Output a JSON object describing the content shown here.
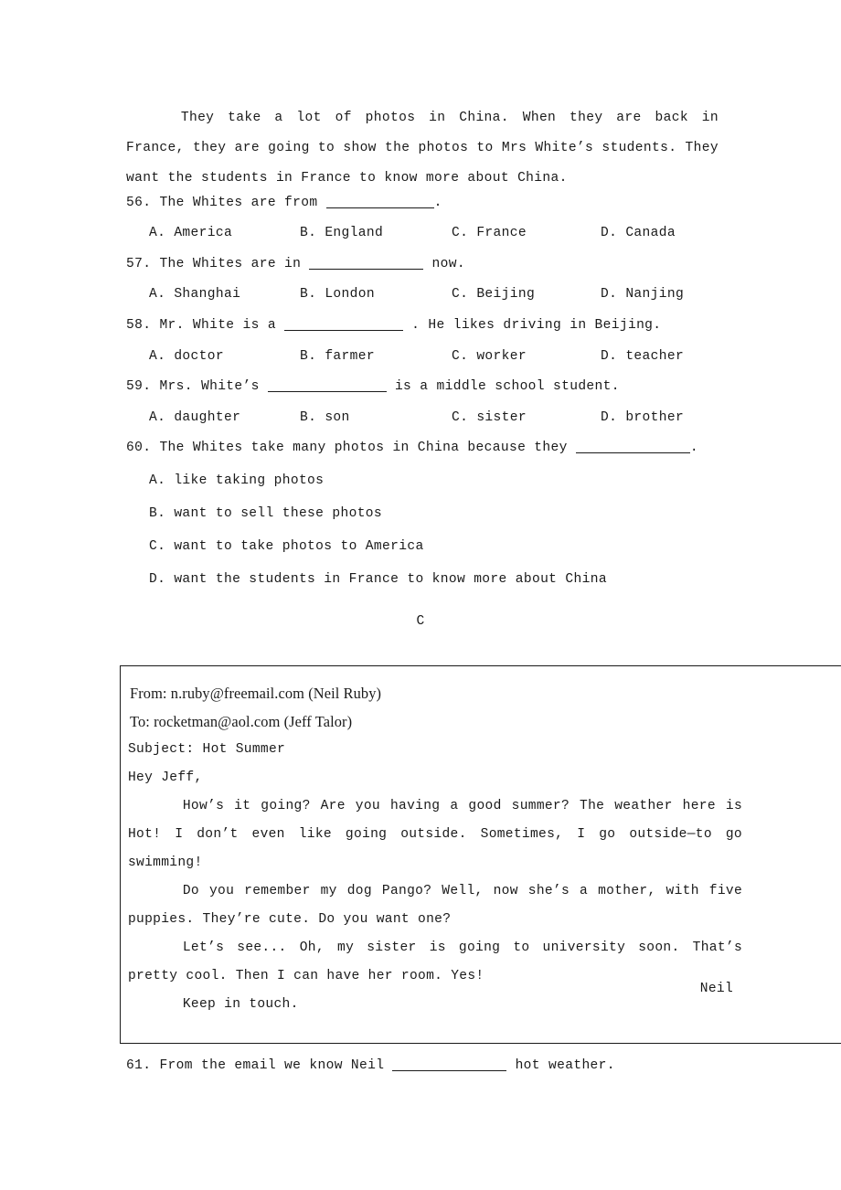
{
  "passage": {
    "lines": [
      "They take a lot of photos in China. When they are back in France, they are",
      "going to show the photos to Mrs White’s students. They want the students in France",
      "to know more about China."
    ]
  },
  "questions": [
    {
      "number": "56.",
      "stem_before": "The Whites are from",
      "stem_after": ".",
      "options": [
        {
          "key": "A.",
          "text": "America"
        },
        {
          "key": "B.",
          "text": "England"
        },
        {
          "key": "C.",
          "text": "France"
        },
        {
          "key": "D.",
          "text": "Canada"
        }
      ]
    },
    {
      "number": "57.",
      "stem_before": "The Whites are in",
      "stem_after": "now.",
      "options": [
        {
          "key": "A.",
          "text": "Shanghai"
        },
        {
          "key": "B.",
          "text": "London"
        },
        {
          "key": "C.",
          "text": "Beijing"
        },
        {
          "key": "D.",
          "text": "Nanjing"
        }
      ]
    },
    {
      "number": "58.",
      "stem_before": "Mr. White is a",
      "stem_after": ". He likes driving in Beijing.",
      "options": [
        {
          "key": "A.",
          "text": "doctor"
        },
        {
          "key": "B.",
          "text": "farmer"
        },
        {
          "key": "C.",
          "text": "worker"
        },
        {
          "key": "D.",
          "text": "teacher"
        }
      ]
    },
    {
      "number": "59.",
      "stem_before": "Mrs. White’s",
      "stem_after": "is a middle school student.",
      "options": [
        {
          "key": "A.",
          "text": "daughter"
        },
        {
          "key": "B.",
          "text": "son"
        },
        {
          "key": "C.",
          "text": "sister"
        },
        {
          "key": "D.",
          "text": "brother"
        }
      ]
    }
  ],
  "question60": {
    "number": "60.",
    "stem_before": "The Whites take many photos in China because they",
    "stem_after": ".",
    "options": [
      {
        "key": "A.",
        "text": "like taking photos"
      },
      {
        "key": "B.",
        "text": "want to sell these photos"
      },
      {
        "key": "C.",
        "text": "want to take photos to America"
      },
      {
        "key": "D.",
        "text": "want the students in France to know more about China"
      }
    ]
  },
  "section_marker": "C",
  "email": {
    "from_line": "From: n.ruby@freemail.com (Neil Ruby)",
    "to_line": "To: rocketman@aol.com (Jeff Talor)",
    "subject_line": "Subject: Hot Summer",
    "greeting": "Hey Jeff,",
    "paragraphs": [
      "How’s it going? Are you having a good summer? The weather here is Hot! I don’t even like going outside. Sometimes, I go outside—to go swimming!",
      "Do you remember my dog Pango? Well, now she’s a mother, with five puppies. They’re cute. Do you want one?",
      "Let’s see... Oh, my sister is going to university soon. That’s pretty cool. Then I can have her room. Yes!",
      "Keep in touch."
    ],
    "signature": "Neil"
  },
  "question61": {
    "number": "61.",
    "stem_before": "From the email we know Neil",
    "stem_after": "hot weather."
  }
}
